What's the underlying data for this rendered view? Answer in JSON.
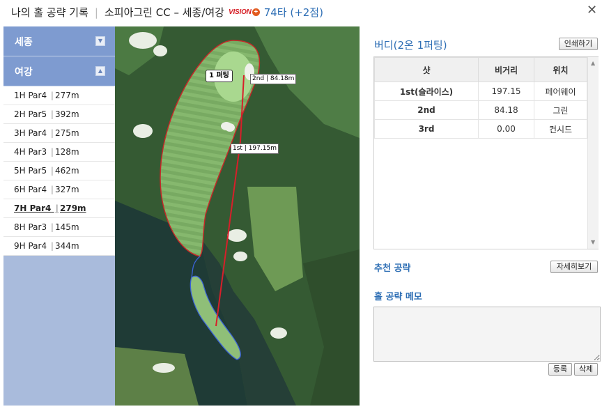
{
  "header": {
    "title": "나의 홀 공략 기록",
    "separator": "|",
    "course": "소피아그린 CC – 세종/여강",
    "brand": "VISION",
    "brand_plus": "+",
    "score": "74타 (+2점)",
    "close": "✕"
  },
  "sidebar": {
    "courses": [
      {
        "name": "세종",
        "toggle": "▼"
      },
      {
        "name": "여강",
        "toggle": "▲"
      }
    ],
    "holes": [
      {
        "hole": "1H Par4",
        "dist": "277m"
      },
      {
        "hole": "2H Par5",
        "dist": "392m"
      },
      {
        "hole": "3H Par4",
        "dist": "275m"
      },
      {
        "hole": "4H Par3",
        "dist": "128m"
      },
      {
        "hole": "5H Par5",
        "dist": "462m"
      },
      {
        "hole": "6H Par4",
        "dist": "327m"
      },
      {
        "hole": "7H Par4",
        "dist": "279m"
      },
      {
        "hole": "8H Par3",
        "dist": "145m"
      },
      {
        "hole": "9H Par4",
        "dist": "344m"
      }
    ],
    "bar": "|"
  },
  "map": {
    "putt_label": "1 퍼팅",
    "shot2_label": "2nd | 84.18m",
    "shot1_label": "1st | 197.15m",
    "colors": {
      "shot_line": "#d81f2a",
      "fairway": "#7fb069",
      "green": "#9fd08a",
      "water": "#1f3d3a",
      "rough": "#3f6a3a"
    }
  },
  "result": {
    "title": "버디(2온 1퍼팅)",
    "print_button": "인쇄하기",
    "columns": [
      "샷",
      "비거리",
      "위치"
    ],
    "rows": [
      [
        "1st(슬라이스)",
        "197.15",
        "페어웨이"
      ],
      [
        "2nd",
        "84.18",
        "그린"
      ],
      [
        "3rd",
        "0.00",
        "컨시드"
      ]
    ]
  },
  "recommend": {
    "title": "추천 공략",
    "detail_button": "자세히보기"
  },
  "memo": {
    "title": "홀 공략 메모",
    "value": "",
    "save_button": "등록",
    "delete_button": "삭제"
  }
}
